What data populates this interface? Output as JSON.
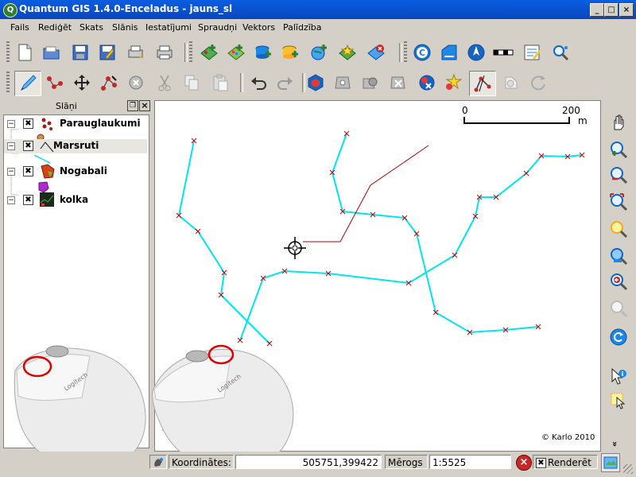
{
  "window": {
    "title": "Quantum GIS 1.4.0-Enceladus - jauns_sl",
    "app_icon_letter": "Q",
    "minimize_glyph": "_",
    "maximize_glyph": "□",
    "close_glyph": "×"
  },
  "menubar": {
    "items": [
      "Fails",
      "Rediģēt",
      "Skats",
      "Slānis",
      "Iestatījumi",
      "Spraudņi",
      "Vektors",
      "Palīdzība"
    ]
  },
  "toolbar1": {
    "icons": [
      "new-project-icon",
      "open-project-icon",
      "save-project-icon",
      "save-as-icon",
      "print-composer-icon",
      "print-icon",
      "add-vector-layer-icon",
      "add-raster-layer-icon",
      "add-postgis-layer-icon",
      "add-spatialite-layer-icon",
      "add-wms-layer-icon",
      "new-vector-layer-icon",
      "remove-layer-icon",
      "copyright-label-icon",
      "scale-bar-icon",
      "north-arrow-icon",
      "scalebar-decoration-icon",
      "composer-icon",
      "plugin-search-icon"
    ]
  },
  "toolbar2": {
    "icons": [
      "toggle-editing-icon",
      "capture-point-icon",
      "move-feature-icon",
      "node-tool-icon",
      "delete-selected-icon",
      "cut-icon",
      "copy-icon",
      "paste-icon",
      "undo-icon",
      "redo-icon",
      "simplify-feature-icon",
      "add-ring-icon",
      "add-island-icon",
      "delete-ring-icon",
      "delete-part-icon",
      "reshape-features-icon",
      "split-features-icon",
      "merge-features-icon",
      "rotate-point-symbols-icon"
    ]
  },
  "legend": {
    "title": "Slāņi",
    "float_glyph": "❐",
    "close_glyph": "×",
    "layers": [
      {
        "name": "Parauglaukumi",
        "checked": "✖",
        "expander": "−",
        "icon": "point-layer-icon"
      },
      {
        "name": "Marsruti",
        "checked": "✖",
        "expander": "−",
        "icon": "line-layer-icon"
      },
      {
        "name": "Nogabali",
        "checked": "✖",
        "expander": "−",
        "icon": "polygon-layer-icon"
      },
      {
        "name": "kolka",
        "checked": "✖",
        "expander": "−",
        "icon": "raster-layer-icon"
      }
    ]
  },
  "map": {
    "scale_left": "0",
    "scale_right": "200",
    "scale_unit": "m",
    "copyright": "© Karlo 2010",
    "line_color": "#00e5ee",
    "vertex_color": "#cc0000",
    "edit_line_color": "#b00000",
    "routes": [
      [
        [
          243,
          176
        ],
        [
          224,
          270
        ],
        [
          248,
          290
        ],
        [
          281,
          342
        ],
        [
          277,
          370
        ],
        [
          338,
          431
        ]
      ],
      [
        [
          301,
          427
        ],
        [
          330,
          349
        ],
        [
          357,
          340
        ],
        [
          412,
          343
        ],
        [
          513,
          355
        ],
        [
          571,
          320
        ],
        [
          597,
          271
        ],
        [
          602,
          247
        ],
        [
          623,
          247
        ],
        [
          661,
          217
        ],
        [
          680,
          195
        ],
        [
          713,
          196
        ],
        [
          731,
          194
        ]
      ],
      [
        [
          435,
          167
        ],
        [
          417,
          216
        ],
        [
          430,
          265
        ],
        [
          468,
          269
        ],
        [
          508,
          273
        ],
        [
          523,
          293
        ],
        [
          547,
          392
        ],
        [
          590,
          417
        ],
        [
          635,
          414
        ],
        [
          676,
          410
        ]
      ]
    ],
    "edit_line": [
      [
        380,
        303
      ],
      [
        427,
        303
      ],
      [
        465,
        232
      ],
      [
        538,
        182
      ]
    ],
    "cursor_point": [
      370,
      311
    ]
  },
  "right_toolbar": {
    "icons": [
      "pan-icon",
      "zoom-in-icon",
      "zoom-out-icon",
      "zoom-full-icon",
      "zoom-to-selection-icon",
      "zoom-to-layer-icon",
      "zoom-last-icon",
      "zoom-next-icon",
      "refresh-icon",
      "identify-icon",
      "select-icon"
    ],
    "more_glyph": "»"
  },
  "statusbar": {
    "coordinates_label": "Koordinātes:",
    "coordinates_value": "505751,399422",
    "scale_label": "Mērogs",
    "scale_value": "1:5525",
    "render_label": "Renderēt",
    "render_checked": "✖",
    "stop_render_glyph": "×"
  }
}
